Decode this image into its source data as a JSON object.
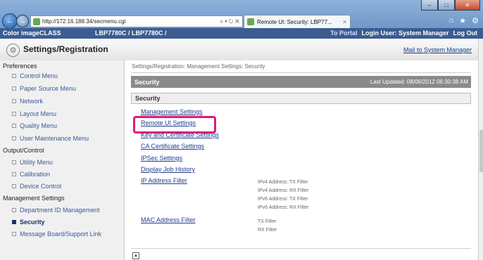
{
  "browser": {
    "url": "http://172.16.188.34/secmenu.cgi",
    "url_controls": "⌕ ▾ ↻ ✕",
    "tab_title": "Remote UI: Security: LBP77...",
    "window_controls": [
      "–",
      "□",
      "✕"
    ],
    "back_label": "←",
    "forward_label": "→",
    "toolbar_icons": [
      "⌂",
      "★",
      "⚙"
    ]
  },
  "app": {
    "product": "Color imageCLASS",
    "model": "LBP7780C / LBP7780C /",
    "to_portal": "To Portal",
    "login_user": "Login User: System Manager",
    "logout": "Log Out",
    "page_title": "Settings/Registration",
    "mail": "Mail to System Manager"
  },
  "sidebar": {
    "preferences": {
      "label": "Preferences",
      "items": [
        "Control Menu",
        "Paper Source Menu",
        "Network",
        "Layout Menu",
        "Quality Menu",
        "User Maintenance Menu"
      ]
    },
    "output": {
      "label": "Output/Control",
      "items": [
        "Utility Menu",
        "Calibration",
        "Device Control"
      ]
    },
    "management": {
      "label": "Management Settings",
      "items": [
        "Department ID Management",
        "Security",
        "Message Board/Support Link"
      ]
    }
  },
  "main": {
    "breadcrumb": "Settings/Registration: Management Settings: Security",
    "section_title": "Security",
    "last_updated": "Last Updated: 08/06/2012 06:30:38 AM",
    "sub_title": "Security",
    "links": [
      "Management Settings",
      "Remote UI Settings",
      "Key and Certificate Settings",
      "CA Certificate Settings",
      "IPSec Settings",
      "Display Job History",
      "IP Address Filter",
      "MAC Address Filter"
    ],
    "ip_filters": [
      "IPv4 Address: TX Filter",
      "IPv4 Address: RX Filter",
      "IPv6 Address: TX Filter",
      "IPv6 Address: RX Filter"
    ],
    "mac_filters": [
      "TX Filter",
      "RX Filter"
    ],
    "scroll_top": "▲"
  }
}
